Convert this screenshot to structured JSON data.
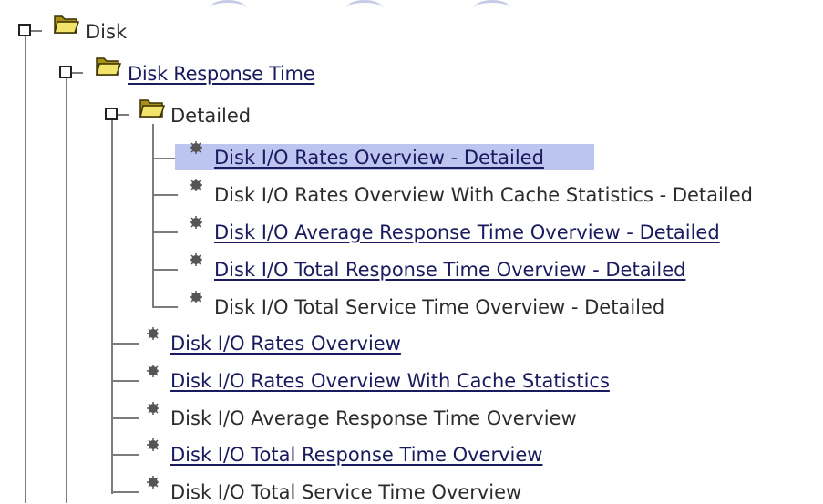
{
  "tree": {
    "root": {
      "label": "Disk",
      "icon": "folder-open-icon"
    },
    "response_time": {
      "label": "Disk Response Time",
      "icon": "folder-open-icon"
    },
    "detailed": {
      "label": "Detailed",
      "icon": "folder-open-icon",
      "items": [
        {
          "label": "Disk I/O Rates Overview - Detailed",
          "link": true,
          "selected": true
        },
        {
          "label": "Disk I/O Rates Overview With Cache Statistics - Detailed",
          "link": false
        },
        {
          "label": "Disk I/O Average Response Time Overview - Detailed",
          "link": true
        },
        {
          "label": "Disk I/O Total Response Time Overview - Detailed",
          "link": true
        },
        {
          "label": "Disk I/O Total Service Time Overview - Detailed",
          "link": false
        }
      ]
    },
    "items": [
      {
        "label": "Disk I/O Rates Overview",
        "link": true
      },
      {
        "label": "Disk I/O Rates Overview With Cache Statistics",
        "link": true
      },
      {
        "label": "Disk I/O Average Response Time Overview",
        "link": false
      },
      {
        "label": "Disk I/O Total Response Time Overview",
        "link": true
      },
      {
        "label": "Disk I/O Total Service Time Overview",
        "link": false
      }
    ]
  },
  "colors": {
    "link": "#1a1a5e",
    "selection": "#bcc4f0",
    "tree_line": "#7c7c7c"
  }
}
